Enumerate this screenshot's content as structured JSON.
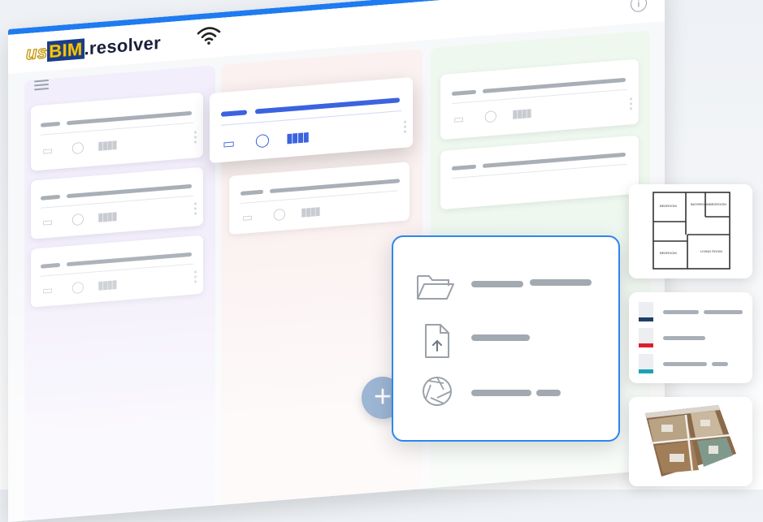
{
  "app": {
    "logo_prefix": "us",
    "logo_mid": "BIM",
    "logo_suffix": ".resolver",
    "info_label": "i"
  },
  "icons": {
    "hamburger": "menu-icon",
    "wifi": "wifi-icon",
    "info": "info-icon",
    "image": "image-icon",
    "chat": "comment-icon",
    "barcode": "barcode-icon",
    "folder": "folder-icon",
    "upload": "file-upload-icon",
    "camera": "camera-shutter-icon",
    "plus": "plus-icon"
  },
  "thumbnails": {
    "floorplan_rooms": [
      "BEDROOM",
      "BATHROOM",
      "BEDROOM",
      "BEDROOM",
      "LIVING ROOM"
    ]
  },
  "colors": {
    "accent": "#1e7bf0",
    "active_card": "#3b63e0",
    "swatch_navy": "#1f3d6b",
    "swatch_red": "#d8202f",
    "swatch_teal": "#1aa3b5",
    "lane_purple": "#f2eefb",
    "lane_red": "#fbf1f1",
    "lane_green": "#eef8ef"
  },
  "popup": {
    "plus_label": "+"
  }
}
